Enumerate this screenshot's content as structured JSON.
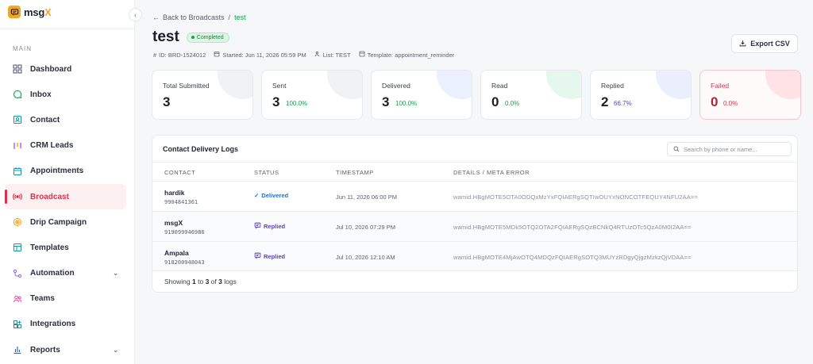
{
  "brand": {
    "name_main": "msg",
    "name_accent": "X"
  },
  "sidebar": {
    "section": "MAIN",
    "items": [
      {
        "label": "Dashboard",
        "icon": "dashboard-icon"
      },
      {
        "label": "Inbox",
        "icon": "chat-bubble-icon"
      },
      {
        "label": "Contact",
        "icon": "contact-card-icon"
      },
      {
        "label": "CRM Leads",
        "icon": "kanban-icon"
      },
      {
        "label": "Appointments",
        "icon": "calendar-icon"
      },
      {
        "label": "Broadcast",
        "icon": "broadcast-icon",
        "active": true
      },
      {
        "label": "Drip Campaign",
        "icon": "drip-icon"
      },
      {
        "label": "Templates",
        "icon": "templates-icon"
      },
      {
        "label": "Automation",
        "icon": "automation-icon",
        "expandable": true
      },
      {
        "label": "Teams",
        "icon": "teams-icon"
      },
      {
        "label": "Integrations",
        "icon": "integrations-icon"
      },
      {
        "label": "Reports",
        "icon": "reports-icon",
        "expandable": true
      }
    ]
  },
  "breadcrumb": {
    "back": "Back to Broadcasts",
    "sep": "/",
    "current": "test"
  },
  "page": {
    "title": "test",
    "status": "Completed",
    "meta": {
      "id": "ID: BRD-1524012",
      "started": "Started: Jun 11, 2026 05:59 PM",
      "list": "List: TEST",
      "template": "Template: appointment_reminder"
    },
    "export_label": "Export CSV"
  },
  "stats": [
    {
      "label": "Total Submitted",
      "value": "3",
      "pct": "",
      "color": "#1a1f2b",
      "blob": "#f1f2f4"
    },
    {
      "label": "Sent",
      "value": "3",
      "pct": "100.0%",
      "color": "#16a34a",
      "blob": "#f1f2f4"
    },
    {
      "label": "Delivered",
      "value": "3",
      "pct": "100.0%",
      "color": "#16a34a",
      "blob": "#eaf1fd"
    },
    {
      "label": "Read",
      "value": "0",
      "pct": "0.0%",
      "color": "#16a34a",
      "blob": "#e6f7ed"
    },
    {
      "label": "Replied",
      "value": "2",
      "pct": "66.7%",
      "color": "#5b3fc8",
      "blob": "#ebeffd"
    },
    {
      "label": "Failed",
      "value": "0",
      "pct": "0.0%",
      "color": "#d9344c",
      "blob": "#fde3e6"
    }
  ],
  "logs": {
    "title": "Contact Delivery Logs",
    "search_placeholder": "Search by phone or name...",
    "columns": [
      "CONTACT",
      "STATUS",
      "TIMESTAMP",
      "DETAILS / META ERROR"
    ],
    "rows": [
      {
        "name": "hardik",
        "phone": "9904841361",
        "status": "Delivered",
        "status_kind": "delivered",
        "timestamp": "Jun 11, 2026 06:00 PM",
        "details": "wamid.HBgMOTE5OTA0ODQxMzYxFQIAERgSQTIwOUYxNONCOTFEQUY4NFU2AA=="
      },
      {
        "name": "msgX",
        "phone": "919099946986",
        "status": "Replied",
        "status_kind": "replied",
        "timestamp": "Jul 10, 2026 07:29 PM",
        "details": "wamid.HBgMOTE5MDk5OTQ2OTA2FQIAERgSQzBCNkQ4RTUzOTc5QzA0M0I2AA=="
      },
      {
        "name": "Ampala",
        "phone": "918200948043",
        "status": "Replied",
        "status_kind": "replied",
        "timestamp": "Jul 10, 2026 12:10 AM",
        "details": "wamid.HBgMOTE4MjAwOTQ4MDQzFQIAERgSOTQ3MUYzRDgyQjgzMzkzQjVDAA=="
      }
    ],
    "footer": {
      "prefix": "Showing",
      "from": "1",
      "to_word": "to",
      "to": "3",
      "of_word": "of",
      "total": "3",
      "suffix": "logs"
    }
  }
}
